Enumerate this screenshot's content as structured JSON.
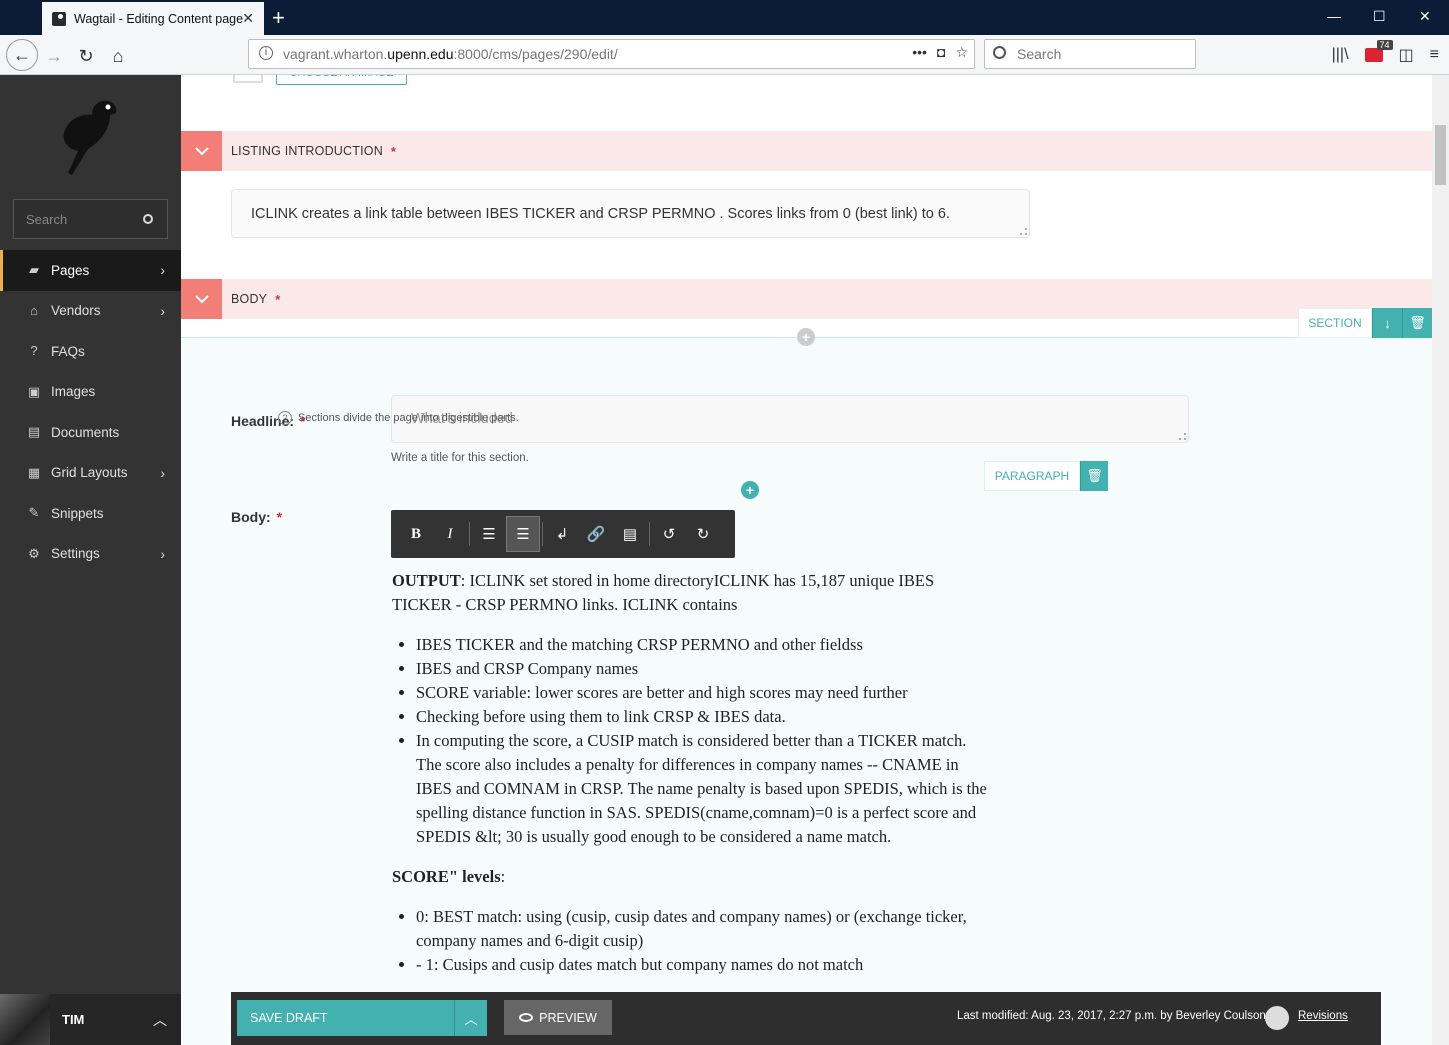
{
  "browser": {
    "tab_title": "Wagtail - Editing Content page",
    "url_prefix": "vagrant.wharton.",
    "url_host": "upenn.edu",
    "url_suffix": ":8000/cms/pages/290/edit/",
    "search_placeholder": "Search",
    "extension_badge": "74"
  },
  "sidebar": {
    "search_placeholder": "Search",
    "items": [
      {
        "label": "Pages",
        "icon": "folder-open-icon",
        "has_submenu": true,
        "active": true
      },
      {
        "label": "Vendors",
        "icon": "bank-icon",
        "has_submenu": true
      },
      {
        "label": "FAQs",
        "icon": "help-icon",
        "has_submenu": false
      },
      {
        "label": "Images",
        "icon": "image-icon",
        "has_submenu": false
      },
      {
        "label": "Documents",
        "icon": "document-icon",
        "has_submenu": false
      },
      {
        "label": "Grid Layouts",
        "icon": "grid-icon",
        "has_submenu": true
      },
      {
        "label": "Snippets",
        "icon": "snippet-icon",
        "has_submenu": false
      },
      {
        "label": "Settings",
        "icon": "cogs-icon",
        "has_submenu": true
      }
    ],
    "user": {
      "name": "TIM"
    }
  },
  "editor": {
    "choose_image_label": "CHOOSE AN IMAGE",
    "listing_intro": {
      "label": "LISTING INTRODUCTION",
      "required": "*",
      "value": "ICLINK creates a link table between IBES TICKER and CRSP PERMNO . Scores links from 0 (best link) to 6."
    },
    "body": {
      "label": "BODY",
      "required": "*",
      "section_block_label": "SECTION",
      "headline_label": "Headline:",
      "headline_required": "*",
      "headline_tip": "Sections divide the page into digestible parts.",
      "headline_value": "What's included",
      "headline_help": "Write a title for this section.",
      "paragraph_block_label": "PARAGRAPH",
      "body_label": "Body:",
      "body_required": "*",
      "content": {
        "output_bold": "OUTPUT",
        "output_rest": ": ICLINK set stored in home directoryICLINK has 15,187 unique IBES TICKER - CRSP PERMNO links. ICLINK contains",
        "list1": [
          "IBES TICKER and the matching CRSP PERMNO and other fieldss",
          "IBES and CRSP Company names",
          "SCORE variable: lower scores are better and high scores may need further",
          "Checking before using them to link CRSP & IBES data.",
          "In computing the score, a CUSIP match is considered better than a TICKER match. The score also includes a penalty for differences in company names -- CNAME in IBES and COMNAM in CRSP. The name penalty is based upon SPEDIS, which is the spelling distance function in SAS. SPEDIS(cname,comnam)=0 is a perfect score and SPEDIS &lt; 30 is usually good enough to be considered a name match."
        ],
        "score_bold": "SCORE\" levels",
        "score_rest": ":",
        "list2": [
          "0: BEST match: using (cusip, cusip dates and company names) or (exchange ticker, company names and 6-digit cusip)",
          "- 1: Cusips and cusip dates match but company names do not match"
        ]
      }
    }
  },
  "footer": {
    "save_draft": "SAVE DRAFT",
    "preview": "PREVIEW",
    "last_modified": "Last modified: Aug. 23, 2017, 2:27 p.m. by Beverley Coulson",
    "revisions": "Revisions"
  },
  "colors": {
    "teal": "#43b1b0",
    "salmon": "#f37e77",
    "sidebar_bg": "#333333"
  }
}
